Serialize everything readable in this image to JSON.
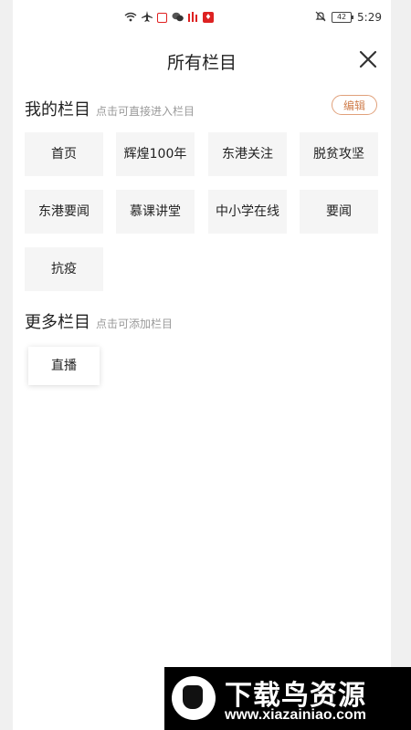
{
  "status_bar": {
    "time": "5:29",
    "battery": "42",
    "icons": [
      "wifi-icon",
      "airplane-icon",
      "app-badge-icon",
      "wechat-icon",
      "app-icon",
      "app-icon-red",
      "mute-icon",
      "battery-icon"
    ]
  },
  "header": {
    "title": "所有栏目",
    "close_icon": "close-icon"
  },
  "my_columns": {
    "title": "我的栏目",
    "hint": "点击可直接进入栏目",
    "edit_label": "编辑",
    "items": [
      {
        "label": "首页"
      },
      {
        "label": "辉煌100年"
      },
      {
        "label": "东港关注"
      },
      {
        "label": "脱贫攻坚"
      },
      {
        "label": "东港要闻"
      },
      {
        "label": "慕课讲堂"
      },
      {
        "label": "中小学在线"
      },
      {
        "label": "要闻"
      },
      {
        "label": "抗疫"
      }
    ]
  },
  "more_columns": {
    "title": "更多栏目",
    "hint": "点击可添加栏目",
    "items": [
      {
        "label": "直播"
      }
    ]
  },
  "watermark": {
    "title": "下载鸟资源",
    "url": "www.xiazainiao.com"
  }
}
